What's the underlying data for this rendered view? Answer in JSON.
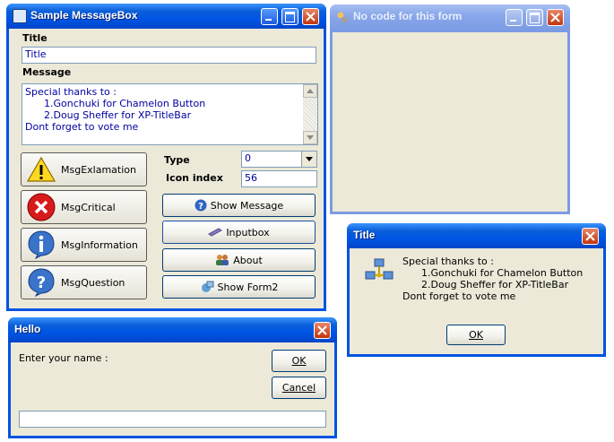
{
  "main_window": {
    "title": "Sample MessageBox",
    "title_label": "Title",
    "title_value": "Title",
    "message_label": "Message",
    "message_lines": [
      "Special thanks to :",
      "      1.Gonchuki for Chamelon Button",
      "      2.Doug Sheffer for XP-TitleBar",
      "Dont forget to vote me"
    ],
    "type_label": "Type",
    "type_value": "0",
    "icon_index_label": "Icon index",
    "icon_index_value": "56",
    "buttons": {
      "msg_exclamation": "MsgExlamation",
      "msg_critical": "MsgCritical",
      "msg_information": "MsgInformation",
      "msg_question": "MsgQuestion",
      "show_message": "Show Message",
      "inputbox": "Inputbox",
      "about": "About",
      "show_form2": "Show Form2"
    }
  },
  "form2_window": {
    "title": "No code for this form"
  },
  "message_dialog": {
    "title": "Title",
    "lines": [
      "Special thanks to :",
      "      1.Gonchuki for Chamelon Button",
      "      2.Doug Sheffer for XP-TitleBar",
      "Dont forget to vote me"
    ],
    "ok_label": "OK",
    "icon": "network-computers-icon"
  },
  "input_dialog": {
    "title": "Hello",
    "prompt": "Enter your name :",
    "ok_label": "OK",
    "cancel_label": "Cancel",
    "input_value": ""
  },
  "colors": {
    "title_active": "#0055e5",
    "title_inactive": "#7b9be4",
    "client": "#ece9d8",
    "text_blue": "#0000a0"
  }
}
